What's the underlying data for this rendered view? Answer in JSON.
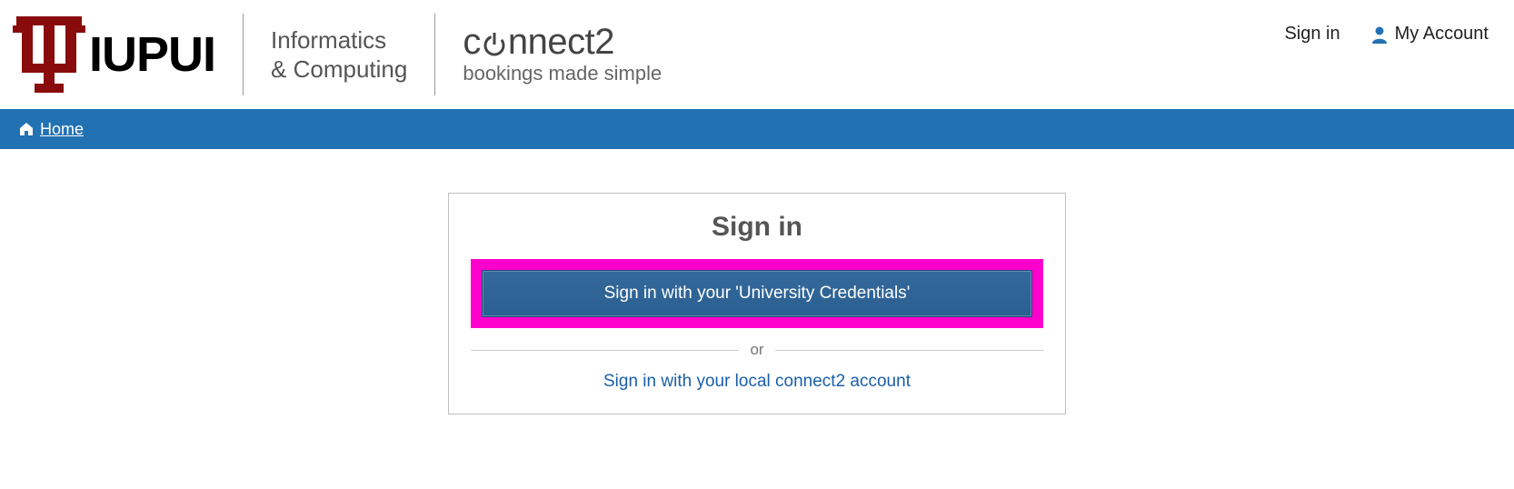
{
  "header": {
    "institution": "IUPUI",
    "dept_line1": "Informatics",
    "dept_line2": "& Computing",
    "app_name_part1": "c",
    "app_name_part2": "nnect2",
    "app_tagline": "bookings made simple",
    "signin_link": "Sign in",
    "account_link": "My Account"
  },
  "nav": {
    "home_label": "Home"
  },
  "signin": {
    "title": "Sign in",
    "primary_button": "Sign in with your 'University Credentials'",
    "or_label": "or",
    "local_link": "Sign in with your local connect2 account"
  },
  "colors": {
    "brand_red": "#8a0b0b",
    "nav_blue": "#2271b3",
    "button_blue": "#2a5f91",
    "highlight_pink": "#ff00cc",
    "link_blue": "#1a5ea8"
  }
}
